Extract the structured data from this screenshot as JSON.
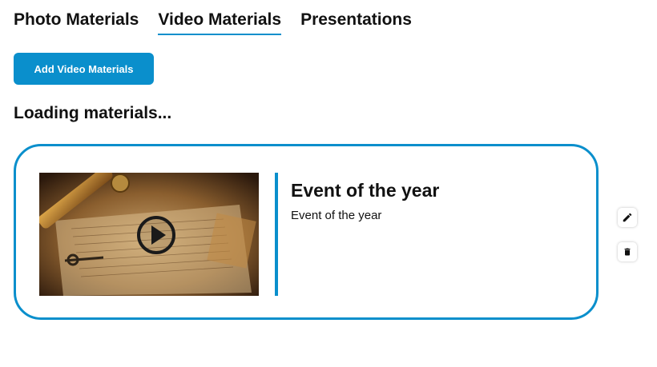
{
  "tabs": [
    {
      "label": "Photo Materials",
      "active": false
    },
    {
      "label": "Video Materials",
      "active": true
    },
    {
      "label": "Presentations",
      "active": false
    }
  ],
  "add_button_label": "Add Video Materials",
  "loading_text": "Loading materials...",
  "materials": [
    {
      "title": "Event of the year",
      "description": "Event of the year",
      "thumbnail_icon": "play-icon",
      "actions": [
        "edit-icon",
        "trash-icon"
      ]
    }
  ],
  "colors": {
    "accent": "#0a8fcc",
    "text": "#111111"
  }
}
